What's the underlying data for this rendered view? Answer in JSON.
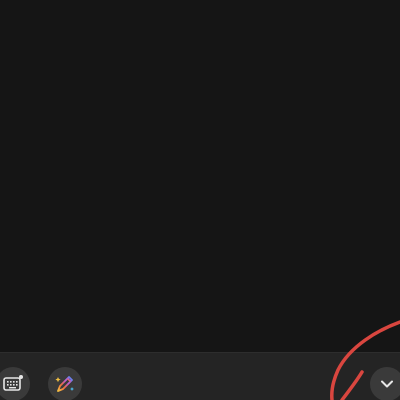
{
  "window": {
    "canvas_background": "#151515",
    "toolbar_background": "#242424"
  },
  "toolbar": {
    "keyboard_button": {
      "icon": "keyboard-icon"
    },
    "pen_button": {
      "icon": "magic-pen-icon"
    },
    "collapse_button": {
      "icon": "chevron-down-icon"
    }
  },
  "ink": {
    "stroke_color": "#d9463f"
  }
}
